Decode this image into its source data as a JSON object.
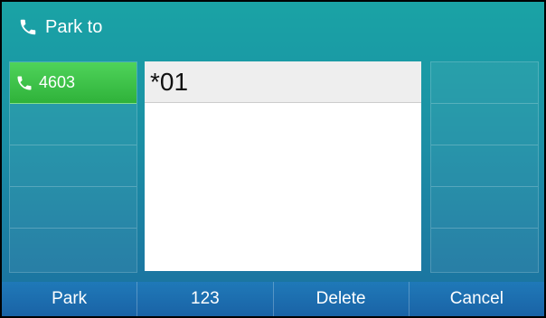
{
  "header": {
    "title": "Park to",
    "icon": "phone-handset-icon"
  },
  "line_keys": [
    {
      "label": "4603",
      "icon": "phone-handset-icon",
      "active": true
    }
  ],
  "input": {
    "value": "*01"
  },
  "softkeys": [
    {
      "label": "Park"
    },
    {
      "label": "123"
    },
    {
      "label": "Delete"
    },
    {
      "label": "Cancel"
    }
  ],
  "colors": {
    "accent": "#1aa3a5",
    "line_active": "#3cc346",
    "softkey_bar": "#1d6fb0"
  }
}
